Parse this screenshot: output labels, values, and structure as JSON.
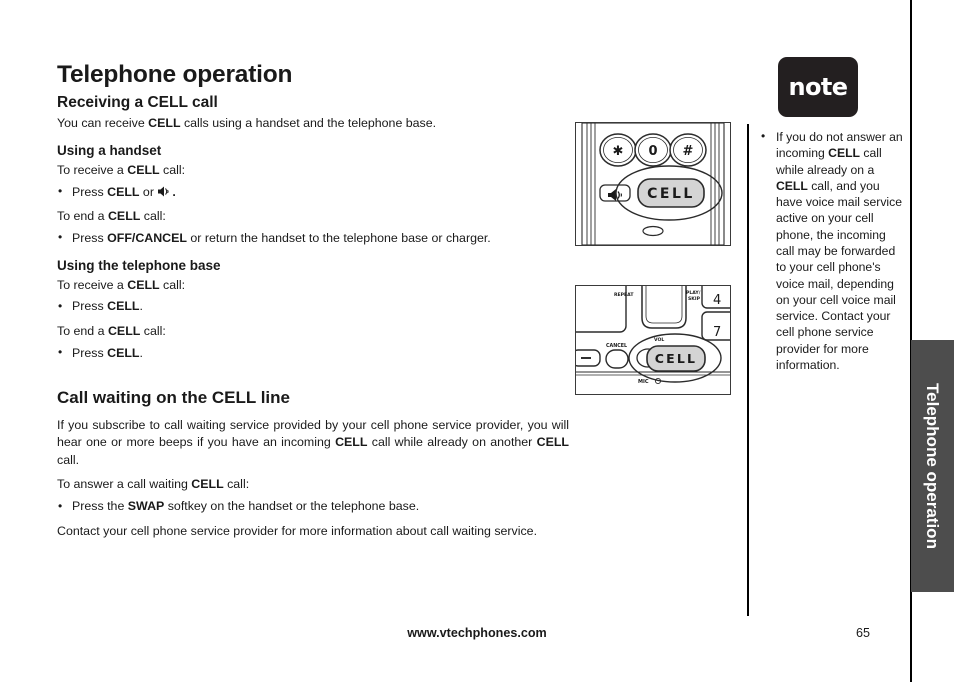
{
  "chapter": {
    "title": "Telephone operation",
    "side_tab_label": "Telephone operation"
  },
  "sections": {
    "receiving": {
      "heading": "Receiving a CELL call",
      "intro_a": "You can receive ",
      "intro_b": "CELL",
      "intro_c": " calls using a handset and the telephone base.",
      "handset": {
        "heading": "Using a handset",
        "receive_lead_a": "To receive a ",
        "receive_lead_b": "CELL",
        "receive_lead_c": " call:",
        "receive_bullet_a": "Press ",
        "receive_bullet_b": "CELL",
        "receive_bullet_c": " or ",
        "receive_bullet_d": ".",
        "end_lead_a": "To end a ",
        "end_lead_b": "CELL",
        "end_lead_c": " call:",
        "end_bullet_a": "Press ",
        "end_bullet_b": "OFF/CANCEL",
        "end_bullet_c": " or return the handset to the telephone base or charger."
      },
      "base": {
        "heading": "Using the telephone base",
        "receive_lead_a": "To receive a ",
        "receive_lead_b": "CELL",
        "receive_lead_c": " call:",
        "receive_bullet_a": "Press ",
        "receive_bullet_b": "CELL",
        "receive_bullet_c": ".",
        "end_lead_a": "To end a ",
        "end_lead_b": "CELL",
        "end_lead_c": " call:",
        "end_bullet_a": "Press ",
        "end_bullet_b": "CELL",
        "end_bullet_c": "."
      }
    },
    "call_waiting": {
      "heading": "Call waiting on the CELL line",
      "para1_a": "If you subscribe to call waiting service provided by your cell phone service provider, you will hear one or more beeps if you have an incoming ",
      "para1_b": "CELL",
      "para1_c": " call while already on another ",
      "para1_d": "CELL",
      "para1_e": " call.",
      "lead_a": "To answer a call waiting ",
      "lead_b": "CELL",
      "lead_c": " call:",
      "bullet_a": "Press the ",
      "bullet_b": "SWAP",
      "bullet_c": " softkey on the handset or the telephone base.",
      "para2": "Contact your cell phone service provider for more information about call waiting service."
    }
  },
  "note": {
    "badge_label": "note",
    "text_a": "If you do not answer an incoming ",
    "text_b": "CELL",
    "text_c": " call while already on a ",
    "text_d": "CELL",
    "text_e": " call, and you have voice mail service active on your cell phone, the incoming call may be forwarded to your cell phone's voice mail, depending on your cell voice mail service. Contact your cell phone service provider for more information."
  },
  "figures": {
    "handset": {
      "caption_keys": [
        "✱",
        "0",
        "#"
      ],
      "cell_key_label": "CELL",
      "speaker_key": "speakerphone-icon"
    },
    "base": {
      "cell_key_label": "CELL",
      "labels": [
        "REPEAT",
        "PLAY/SKIP",
        "4",
        "7",
        "CANCEL",
        "VOL",
        "MIC"
      ]
    }
  },
  "footer": {
    "url": "www.vtechphones.com",
    "page_number": "65"
  },
  "colors": {
    "text": "#1a1a1a",
    "note_badge_bg": "#231f20",
    "side_tab_bg": "#4d4d4d",
    "key_fill": "#d4d4d4"
  }
}
